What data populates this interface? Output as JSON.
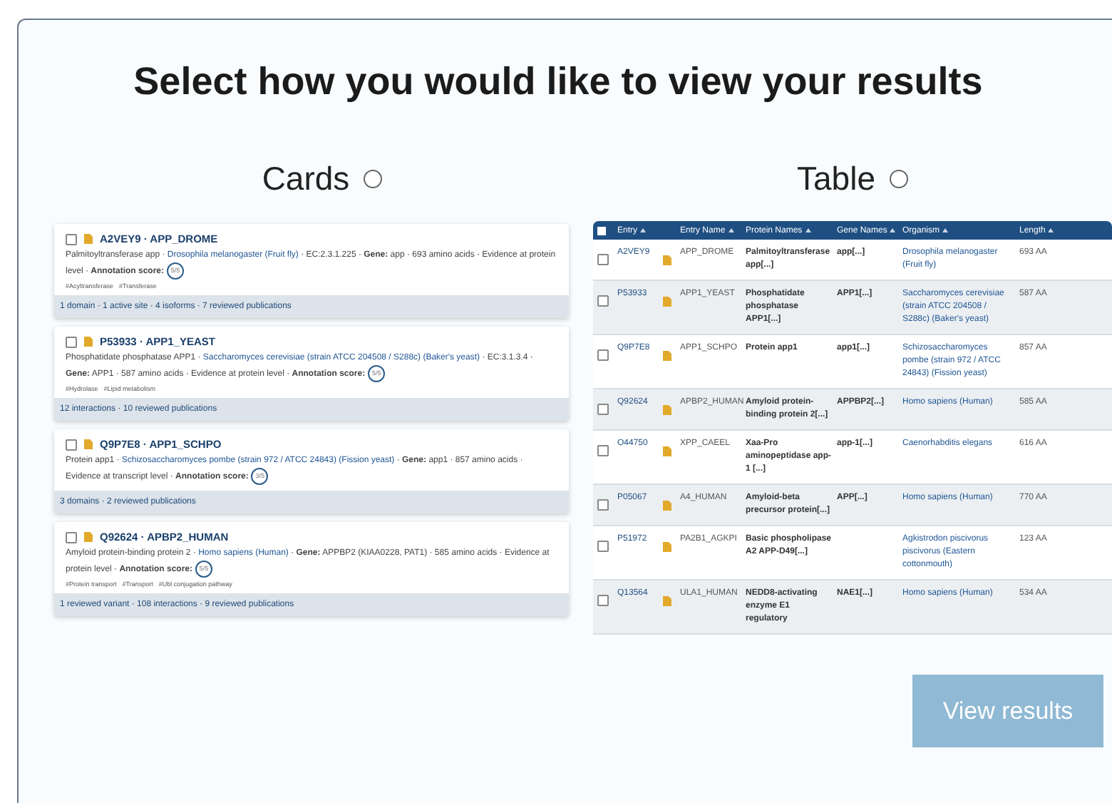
{
  "dialog": {
    "title": "Select how you would like to view your results"
  },
  "views": [
    {
      "kind": "cards",
      "label": "Cards",
      "selected": false
    },
    {
      "kind": "table",
      "label": "Table",
      "selected": false
    }
  ],
  "cards_preview": [
    {
      "checked": false,
      "title": "A2VEY9 · APP_DROME",
      "description": [
        {
          "kind": "text",
          "text": "Palmitoyltransferase app · "
        },
        {
          "kind": "link",
          "text": "Drosophila melanogaster (Fruit fly)"
        },
        {
          "kind": "text",
          "text": " · EC:2.3.1.225 · **Gene:** app · 693 amino acids · Evidence at protein level · **Annotation score:**"
        }
      ],
      "score": "5/5",
      "keywords": [
        "#Acyltransferase",
        "#Transferase"
      ],
      "stats": "1 domain · 1 active site · 4 isoforms · 7 reviewed publications"
    },
    {
      "checked": false,
      "title": "P53933 · APP1_YEAST",
      "description": [
        {
          "kind": "text",
          "text": "Phosphatidate phosphatase APP1 · "
        },
        {
          "kind": "link",
          "text": "Saccharomyces cerevisiae (strain ATCC 204508 / S288c) (Baker's yeast)"
        },
        {
          "kind": "text",
          "text": " · EC:3.1.3.4 · **Gene:** APP1 · 587 amino acids · Evidence at protein level · **Annotation score:**"
        }
      ],
      "score": "5/5",
      "keywords": [
        "#Hydrolase",
        "#Lipid metabolism"
      ],
      "stats": "12 interactions · 10 reviewed publications"
    },
    {
      "checked": false,
      "title": "Q9P7E8 · APP1_SCHPO",
      "description": [
        {
          "kind": "text",
          "text": "Protein app1 · "
        },
        {
          "kind": "link",
          "text": "Schizosaccharomyces pombe (strain 972 / ATCC 24843) (Fission yeast)"
        },
        {
          "kind": "text",
          "text": " · **Gene:** app1 · 857 amino acids · Evidence at transcript level · **Annotation score:**"
        }
      ],
      "score": "3/5",
      "stats": "3 domains · 2 reviewed publications"
    },
    {
      "checked": false,
      "title": "Q92624 · APBP2_HUMAN",
      "description": [
        {
          "kind": "text",
          "text": "Amyloid protein-binding protein 2 · "
        },
        {
          "kind": "link",
          "text": "Homo sapiens (Human)"
        },
        {
          "kind": "text",
          "text": " · **Gene:** APPBP2 (KIAA0228, PAT1) · 585 amino acids · Evidence at protein level · **Annotation score:**"
        }
      ],
      "score": "5/5",
      "keywords": [
        "#Protein transport",
        "#Transport",
        "#Ubl conjugation pathway"
      ],
      "stats": "1 reviewed variant · 108 interactions · 9 reviewed publications"
    }
  ],
  "table_preview": {
    "all_checked": false,
    "columns": [
      "Entry",
      "Entry Name",
      "Protein Names",
      "Gene Names",
      "Organism",
      "Length"
    ],
    "rows": [
      {
        "checked": false,
        "entry": "A2VEY9",
        "entry_name": "APP_DROME",
        "protein": "Palmitoyltransferase app[...]",
        "gene": "app[...]",
        "organism": "Drosophila melanogaster (Fruit fly)",
        "length": "693 AA"
      },
      {
        "checked": false,
        "entry": "P53933",
        "entry_name": "APP1_YEAST",
        "protein": "Phosphatidate phosphatase APP1[...]",
        "gene": "APP1[...]",
        "organism": "Saccharomyces cerevisiae (strain ATCC 204508 / S288c) (Baker's yeast)",
        "length": "587 AA"
      },
      {
        "checked": false,
        "entry": "Q9P7E8",
        "entry_name": "APP1_SCHPO",
        "protein": "Protein app1",
        "gene": "app1[...]",
        "organism": "Schizosaccharomyces pombe (strain 972 / ATCC 24843) (Fission yeast)",
        "length": "857 AA"
      },
      {
        "checked": false,
        "entry": "Q92624",
        "entry_name": "APBP2_HUMAN",
        "protein": "Amyloid protein-binding protein 2[...]",
        "gene": "APPBP2[...]",
        "organism": "Homo sapiens (Human)",
        "length": "585 AA"
      },
      {
        "checked": false,
        "entry": "O44750",
        "entry_name": "XPP_CAEEL",
        "protein": "Xaa-Pro aminopeptidase app-1 [...]",
        "gene": "app-1[...]",
        "organism": "Caenorhabditis elegans",
        "length": "616 AA"
      },
      {
        "checked": false,
        "entry": "P05067",
        "entry_name": "A4_HUMAN",
        "protein": "Amyloid-beta precursor protein[...]",
        "gene": "APP[...]",
        "organism": "Homo sapiens (Human)",
        "length": "770 AA"
      },
      {
        "checked": false,
        "entry": "P51972",
        "entry_name": "PA2B1_AGKPI",
        "protein": "Basic phospholipase A2 APP-D49[...]",
        "organism": "Agkistrodon piscivorus piscivorus (Eastern cottonmouth)",
        "length": "123 AA"
      },
      {
        "checked": false,
        "entry": "Q13564",
        "entry_name": "ULA1_HUMAN",
        "protein": "NEDD8-activating enzyme E1 regulatory",
        "gene": "NAE1[...]",
        "organism": "Homo sapiens (Human)",
        "length": "534 AA"
      }
    ]
  },
  "action": {
    "label": "View results",
    "disabled": true
  }
}
